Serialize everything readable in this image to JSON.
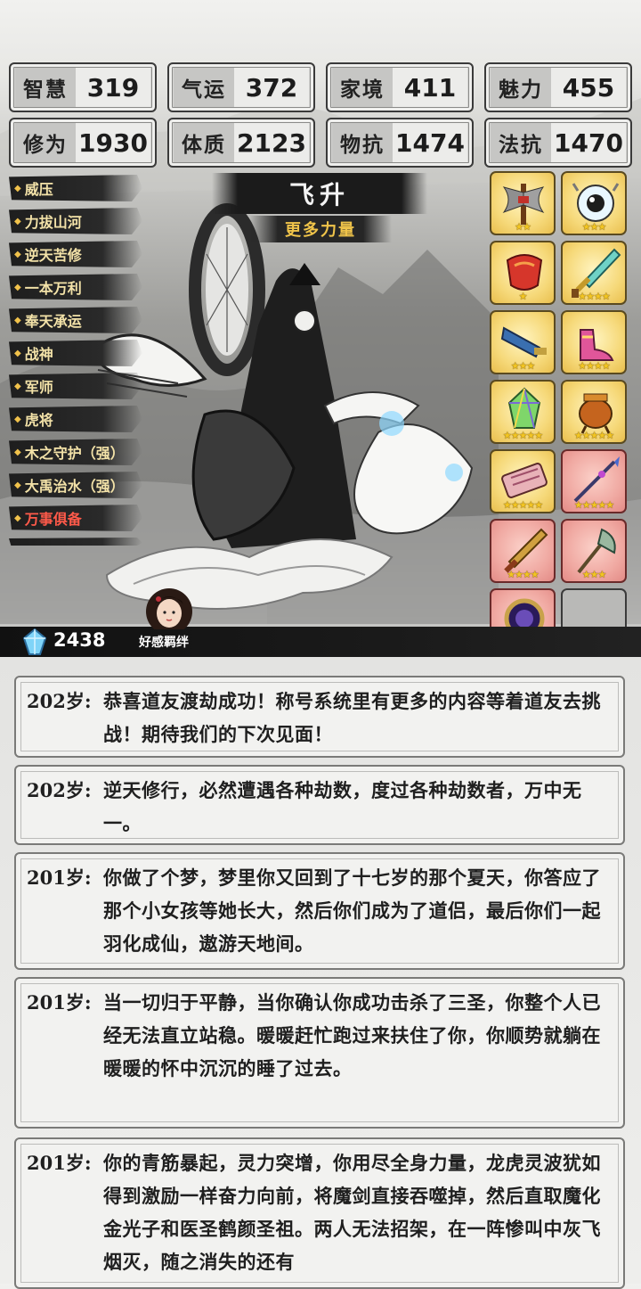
{
  "stats": [
    {
      "label": "智慧",
      "value": "319"
    },
    {
      "label": "气运",
      "value": "372"
    },
    {
      "label": "家境",
      "value": "411"
    },
    {
      "label": "魅力",
      "value": "455"
    },
    {
      "label": "修为",
      "value": "1930"
    },
    {
      "label": "体质",
      "value": "2123"
    },
    {
      "label": "物抗",
      "value": "1474"
    },
    {
      "label": "法抗",
      "value": "1470"
    }
  ],
  "traits": [
    {
      "label": "威压"
    },
    {
      "label": "力拔山河"
    },
    {
      "label": "逆天苦修"
    },
    {
      "label": "一本万利"
    },
    {
      "label": "奉天承运"
    },
    {
      "label": "战神"
    },
    {
      "label": "军师"
    },
    {
      "label": "虎将"
    },
    {
      "label": "木之守护（强）"
    },
    {
      "label": "大禹治水（强）"
    },
    {
      "label": "万事俱备",
      "highlight": "red"
    }
  ],
  "title": "飞升",
  "subtitle": "更多力量",
  "items": [
    {
      "icon": "battle-axe-icon",
      "stars": 2,
      "bg": "gold"
    },
    {
      "icon": "eye-talisman-icon",
      "stars": 3,
      "bg": "gold"
    },
    {
      "icon": "red-armor-icon",
      "stars": 1,
      "bg": "gold"
    },
    {
      "icon": "jade-sword-icon",
      "stars": 4,
      "bg": "gold"
    },
    {
      "icon": "blue-blade-icon",
      "stars": 3,
      "bg": "gold"
    },
    {
      "icon": "pink-boots-icon",
      "stars": 4,
      "bg": "gold"
    },
    {
      "icon": "rainbow-crystal-icon",
      "stars": 5,
      "bg": "gold"
    },
    {
      "icon": "bronze-cauldron-icon",
      "stars": 5,
      "bg": "gold"
    },
    {
      "icon": "scroll-icon",
      "stars": 5,
      "bg": "gold"
    },
    {
      "icon": "spear-icon",
      "stars": 5,
      "bg": "red"
    },
    {
      "icon": "golden-sword-icon",
      "stars": 4,
      "bg": "red"
    },
    {
      "icon": "jade-axe-icon",
      "stars": 3,
      "bg": "red"
    },
    {
      "icon": "mirror-icon",
      "stars": 2,
      "bg": "red"
    },
    {
      "icon": "",
      "stars": 0,
      "bg": "empty"
    }
  ],
  "currency": {
    "icon": "crystal-icon",
    "value": "2438"
  },
  "affinity_label": "好感羁绊",
  "log": [
    {
      "age": "202岁:",
      "text": "恭喜道友渡劫成功！称号系统里有更多的内容等着道友去挑战！期待我们的下次见面！"
    },
    {
      "age": "202岁:",
      "text": "逆天修行，必然遭遇各种劫数，度过各种劫数者，万中无一。"
    },
    {
      "age": "201岁:",
      "text": "你做了个梦，梦里你又回到了十七岁的那个夏天，你答应了那个小女孩等她长大，然后你们成为了道侣，最后你们一起羽化成仙，遨游天地间。"
    },
    {
      "age": "201岁:",
      "text": "当一切归于平静，当你确认你成功击杀了三圣，你整个人已经无法直立站稳。暖暖赶忙跑过来扶住了你，你顺势就躺在暖暖的怀中沉沉的睡了过去。"
    },
    {
      "age": "201岁:",
      "text": "你的青筋暴起，灵力突增，你用尽全身力量，龙虎灵波犹如得到激励一样奋力向前，将魔剑直接吞噬掉，然后直取魔化金光子和医圣鹤颜圣祖。两人无法招架，在一阵惨叫中灰飞烟灭，随之消失的还有"
    }
  ]
}
